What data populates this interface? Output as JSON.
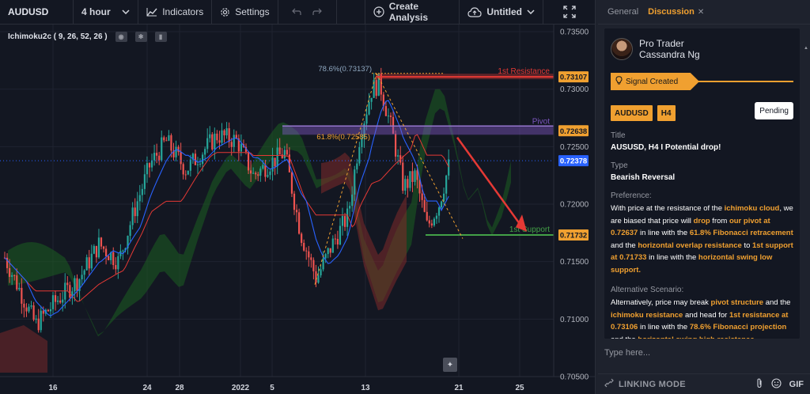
{
  "toolbar": {
    "symbol": "AUDUSD",
    "interval": "4 hour",
    "indicators_label": "Indicators",
    "settings_label": "Settings",
    "create_analysis_label": "Create Analysis",
    "untitled_label": "Untitled",
    "icons": [
      "interval-dropdown-icon",
      "indicators-icon",
      "settings-icon",
      "undo-icon",
      "redo-icon",
      "plus-icon",
      "cloud-upload-icon",
      "chevron-down-icon",
      "fullscreen-icon"
    ]
  },
  "legend": {
    "indicator": "Ichimoku2c ( 9, 26, 52, 26 )"
  },
  "chart_data": {
    "type": "candlestick",
    "symbol": "AUDUSD",
    "timeframe": "4 hour",
    "price_axis_ticks": [
      "0.73500",
      "0.73000",
      "0.72500",
      "0.72000",
      "0.71500",
      "0.71000",
      "0.70500"
    ],
    "time_axis_ticks": [
      "16",
      "24",
      "28",
      "2022",
      "5",
      "13",
      "21",
      "25"
    ],
    "price_labels": [
      {
        "value": "0.73107",
        "color": "#f0a030"
      },
      {
        "value": "0.72638",
        "color": "#f0a030"
      },
      {
        "value": "0.72378",
        "color": "#2962ff"
      },
      {
        "value": "0.71732",
        "color": "#f0a030"
      }
    ],
    "levels": [
      {
        "name": "1st Resistance",
        "price": 0.73107,
        "color": "#e53935"
      },
      {
        "name": "Pivot",
        "price": 0.72638,
        "color": "#7e57c2"
      },
      {
        "name": "1st Support",
        "price": 0.71732,
        "color": "#43a047"
      }
    ],
    "fib_labels": [
      "78.6%(0.73137)",
      "61.8%(0.72585)"
    ],
    "ylim": [
      0.705,
      0.735
    ]
  },
  "panel": {
    "tabs": [
      "General",
      "Discussion"
    ],
    "active_tab": "Discussion",
    "author_role": "Pro Trader",
    "author_name": "Cassandra Ng",
    "signal_label": "Signal Created",
    "badges": [
      "AUDUSD",
      "H4"
    ],
    "status": "Pending",
    "title_label": "Title",
    "title_value": "AUSUSD, H4 I Potential drop!",
    "type_label": "Type",
    "type_value": "Bearish Reversal",
    "preference_label": "Preference:",
    "alt_label": "Alternative Scenario:",
    "composer_placeholder": "Type here...",
    "footer_label": "LINKING MODE",
    "gif_label": "GIF"
  },
  "preference_text": [
    {
      "t": "With price at the resistance of the ",
      "h": false
    },
    {
      "t": "ichimoku cloud",
      "h": true
    },
    {
      "t": ", we are biased that price will ",
      "h": false
    },
    {
      "t": "drop",
      "h": true
    },
    {
      "t": " from ",
      "h": false
    },
    {
      "t": "our pivot at 0.72637",
      "h": true
    },
    {
      "t": " in line with the ",
      "h": false
    },
    {
      "t": "61.8% Fibonacci retracement",
      "h": true
    },
    {
      "t": " and the ",
      "h": false
    },
    {
      "t": "horizontal overlap resistance",
      "h": true
    },
    {
      "t": " to ",
      "h": false
    },
    {
      "t": "1st support at 0.71733",
      "h": true
    },
    {
      "t": " in line with the ",
      "h": false
    },
    {
      "t": "horizontal swing low support.",
      "h": true
    }
  ],
  "alt_text": [
    {
      "t": "Alternatively, price may break ",
      "h": false
    },
    {
      "t": "pivot structure",
      "h": true
    },
    {
      "t": " and the ",
      "h": false
    },
    {
      "t": "ichimoku resistance",
      "h": true
    },
    {
      "t": " and head for ",
      "h": false
    },
    {
      "t": "1st resistance at 0.73106",
      "h": true
    },
    {
      "t": " in line with the ",
      "h": false
    },
    {
      "t": "78.6% Fibonacci projection",
      "h": true
    },
    {
      "t": " and the ",
      "h": false
    },
    {
      "t": "horizontal swing high resistance.",
      "h": true
    }
  ]
}
